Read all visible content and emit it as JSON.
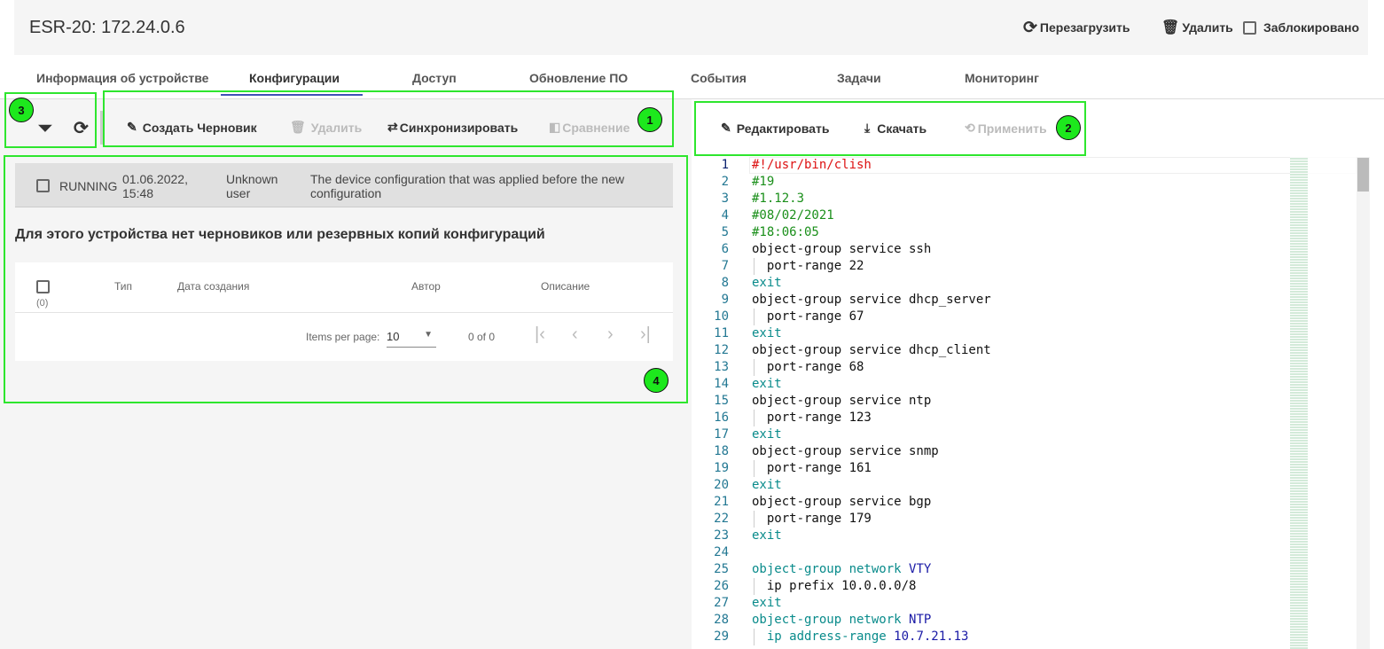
{
  "header": {
    "title": "ESR-20: 172.24.0.6",
    "reload": "Перезагрузить",
    "delete": "Удалить",
    "locked": "Заблокировано"
  },
  "tabs": [
    "Информация об устройстве",
    "Конфигурации",
    "Доступ",
    "Обновление ПО",
    "События",
    "Задачи",
    "Мониторинг"
  ],
  "toolbar": {
    "create": "Создать Черновик",
    "delete": "Удалить",
    "sync": "Синхронизировать",
    "compare": "Сравнение",
    "edit": "Редактировать",
    "download": "Скачать",
    "apply": "Применить"
  },
  "callouts": [
    "1",
    "2",
    "3",
    "4"
  ],
  "running": {
    "name": "RUNNING",
    "date": "01.06.2022,",
    "time": "15:48",
    "user1": "Unknown",
    "user2": "user",
    "desc1": "The device configuration that was applied before the new",
    "desc2": "configuration"
  },
  "no_drafts": "Для этого устройства нет черновиков или резервных копий конфигураций",
  "table": {
    "headers": [
      "Тип",
      "Дата создания",
      "Автор",
      "Описание"
    ],
    "count": "(0)",
    "items_per_page_label": "Items per page:",
    "items_per_page": "10",
    "range": "0 of 0"
  },
  "code": [
    [
      [
        "#!/usr/bin/clish",
        "red"
      ]
    ],
    [
      [
        "#19",
        "green"
      ]
    ],
    [
      [
        "#1.12.3",
        "green"
      ]
    ],
    [
      [
        "#08/02/2021",
        "green"
      ]
    ],
    [
      [
        "#18:06:05",
        "green"
      ]
    ],
    [
      [
        "object-group service ssh",
        "black"
      ]
    ],
    [
      [
        "  port-range 22",
        "black"
      ]
    ],
    [
      [
        "exit",
        "teal"
      ]
    ],
    [
      [
        "object-group service dhcp_server",
        "black"
      ]
    ],
    [
      [
        "  port-range 67",
        "black"
      ]
    ],
    [
      [
        "exit",
        "teal"
      ]
    ],
    [
      [
        "object-group service dhcp_client",
        "black"
      ]
    ],
    [
      [
        "  port-range 68",
        "black"
      ]
    ],
    [
      [
        "exit",
        "teal"
      ]
    ],
    [
      [
        "object-group service ntp",
        "black"
      ]
    ],
    [
      [
        "  port-range 123",
        "black"
      ]
    ],
    [
      [
        "exit",
        "teal"
      ]
    ],
    [
      [
        "object-group service snmp",
        "black"
      ]
    ],
    [
      [
        "  port-range 161",
        "black"
      ]
    ],
    [
      [
        "exit",
        "teal"
      ]
    ],
    [
      [
        "object-group service bgp",
        "black"
      ]
    ],
    [
      [
        "  port-range 179",
        "black"
      ]
    ],
    [
      [
        "exit",
        "teal"
      ]
    ],
    [],
    [
      [
        "object-group network ",
        "teal"
      ],
      [
        "VTY",
        "navy"
      ]
    ],
    [
      [
        "  ip prefix 10.0.0.0/8",
        "black"
      ]
    ],
    [
      [
        "exit",
        "teal"
      ]
    ],
    [
      [
        "object-group network ",
        "teal"
      ],
      [
        "NTP",
        "navy"
      ]
    ],
    [
      [
        "  ip address-range ",
        "teal"
      ],
      [
        "10.7.21.13",
        "navy"
      ]
    ]
  ]
}
